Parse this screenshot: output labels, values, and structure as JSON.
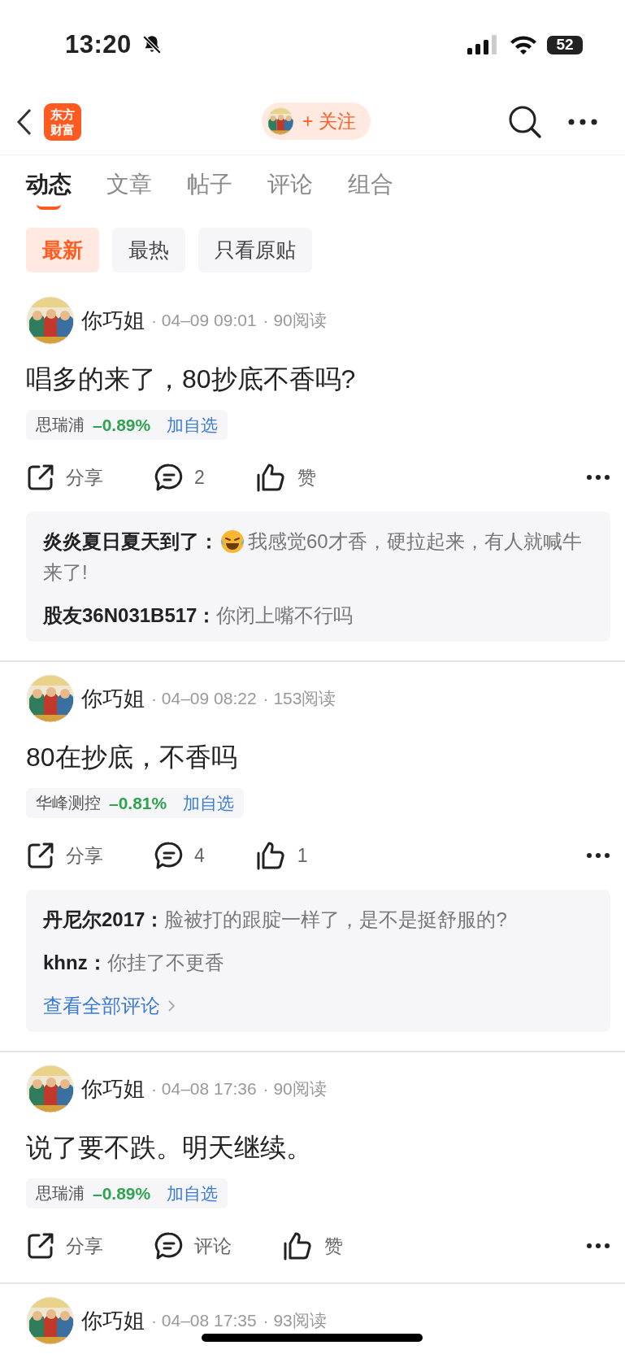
{
  "status_bar": {
    "time": "13:20",
    "battery": "52"
  },
  "nav_bar": {
    "logo": "东方财富",
    "follow_button": "+ 关注"
  },
  "tabs": [
    {
      "label": "动态",
      "selected": true
    },
    {
      "label": "文章",
      "selected": false
    },
    {
      "label": "帖子",
      "selected": false
    },
    {
      "label": "评论",
      "selected": false
    },
    {
      "label": "组合",
      "selected": false
    }
  ],
  "filters": [
    {
      "label": "最新",
      "selected": true
    },
    {
      "label": "最热",
      "selected": false
    },
    {
      "label": "只看原贴",
      "selected": false
    }
  ],
  "posts": [
    {
      "author": "你巧姐",
      "time": "· 04–09 09:01",
      "reads": "· 90阅读",
      "content": "唱多的来了，80抄底不香吗?",
      "stock": {
        "name": "思瑞浦",
        "change": "–0.89%",
        "action": "加自选"
      },
      "share": "分享",
      "comments": "2",
      "likes": "赞",
      "replies": [
        {
          "author": "炎炎夏日夏天到了：",
          "emoji": true,
          "text": "我感觉60才香，硬拉起来，有人就喊牛来了!"
        },
        {
          "author": "股友36N031B517：",
          "emoji": false,
          "text": "你闭上嘴不行吗"
        }
      ]
    },
    {
      "author": "你巧姐",
      "time": "· 04–09 08:22",
      "reads": "· 153阅读",
      "content": "80在抄底，不香吗",
      "stock": {
        "name": "华峰测控",
        "change": "–0.81%",
        "action": "加自选"
      },
      "share": "分享",
      "comments": "4",
      "likes": "1",
      "replies": [
        {
          "author": "丹尼尔2017：",
          "emoji": false,
          "text": "脸被打的跟腚一样了，是不是挺舒服的?"
        },
        {
          "author": "khnz：",
          "emoji": false,
          "text": "你挂了不更香"
        }
      ],
      "view_all": "查看全部评论"
    },
    {
      "author": "你巧姐",
      "time": "· 04–08 17:36",
      "reads": "· 90阅读",
      "content": "说了要不跌。明天继续。",
      "stock": {
        "name": "思瑞浦",
        "change": "–0.89%",
        "action": "加自选"
      },
      "share": "分享",
      "comments": "评论",
      "likes": "赞"
    },
    {
      "author": "你巧姐",
      "time": "· 04–08 17:35",
      "reads": "· 93阅读"
    }
  ]
}
